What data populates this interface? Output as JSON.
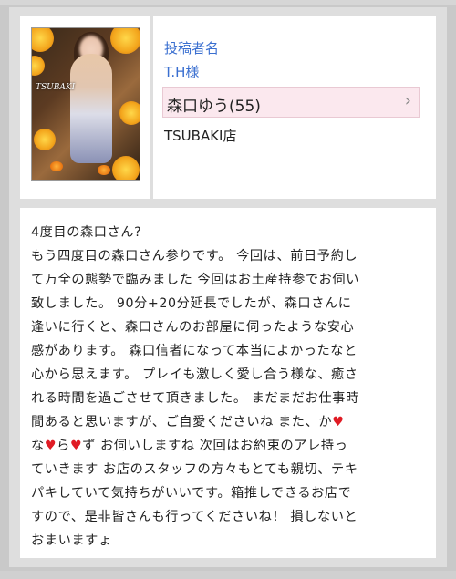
{
  "poster": {
    "label": "投稿者名",
    "name": "T.H様"
  },
  "photo": {
    "watermark": "TSUBAKI"
  },
  "girl": {
    "name_age": "森口ゆう(55)",
    "chevron": "›"
  },
  "shop": {
    "name": "TSUBAKI店"
  },
  "review": {
    "lines": [
      "4度目の森口さん?",
      "もう四度目の森口さん参りです。 今回は、前日予約し",
      "て万全の態勢で臨みました 今回はお土産持参でお伺い",
      "致しました。 90分+20分延長でしたが、森口さんに",
      "逢いに行くと、森口さんのお部屋に伺ったような安心",
      "感があります。 森口信者になって本当によかったなと",
      "心から思えます。 プレイも激しく愛し合う様な、癒さ",
      "れる時間を過ごさせて頂きました。 まだまだお仕事時",
      "間あると思いますが、ご自愛くださいね また、か",
      "な",
      "ら",
      "ず お伺いしますね 次回はお約束のアレ持っ",
      "ていきます お店のスタッフの方々もとても親切、テキ",
      "パキしていて気持ちがいいです。箱推しできるお店で",
      "すので、是非皆さんも行ってくださいね！ 損しないと",
      "おまいますょ"
    ],
    "heart": "♥"
  },
  "colors": {
    "accent_link": "#3a6fd0",
    "girl_bg": "#fbe8ee",
    "heart": "#e01b24"
  }
}
